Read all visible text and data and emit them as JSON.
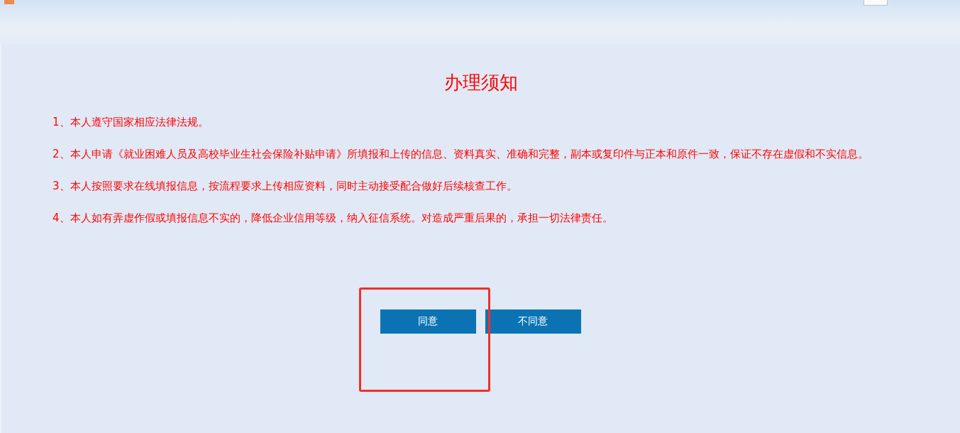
{
  "notice": {
    "title": "办理须知",
    "items": [
      "1、本人遵守国家相应法律法规。",
      "2、本人申请《就业困难人员及高校毕业生社会保险补贴申请》所填报和上传的信息、资料真实、准确和完整，副本或复印件与正本和原件一致，保证不存在虚假和不实信息。",
      "3、本人按照要求在线填报信息，按流程要求上传相应资料，同时主动接受配合做好后续核查工作。",
      "4、本人如有弄虚作假或填报信息不实的，降低企业信用等级，纳入征信系统。对造成严重后果的，承担一切法律责任。"
    ]
  },
  "buttons": [
    "同意",
    "不同意"
  ]
}
